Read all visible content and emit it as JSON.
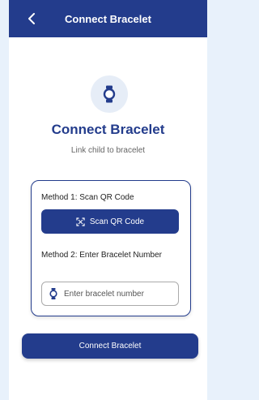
{
  "header": {
    "title": "Connect Bracelet",
    "back_icon": "chevron-left-icon"
  },
  "hero": {
    "icon": "watch-icon",
    "title": "Connect Bracelet",
    "subtitle": "Link child to bracelet"
  },
  "card": {
    "method1_label": "Method 1: Scan QR Code",
    "scan_button_label": "Scan QR Code",
    "scan_icon": "qr-scan-icon",
    "method2_label": "Method 2: Enter Bracelet Number",
    "input_placeholder": "Enter bracelet number",
    "input_value": "",
    "input_icon": "watch-icon"
  },
  "footer": {
    "connect_button_label": "Connect Bracelet"
  },
  "colors": {
    "primary": "#233c8c",
    "background": "#e8f1fb",
    "icon_circle": "#e6edf7"
  }
}
